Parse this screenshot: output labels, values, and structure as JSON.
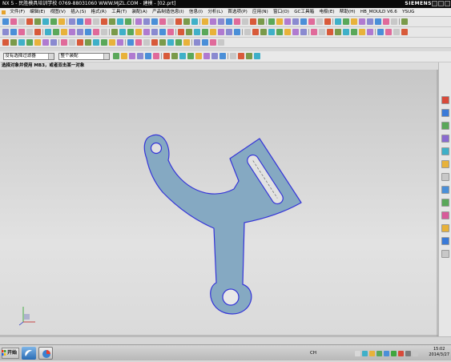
{
  "window": {
    "title": "NX 5 - 民胜模具培训学校 0769-88031060 WWW.MJZL.COM - 建模 - [02.prt]",
    "brand": "SIEMENS"
  },
  "menu": {
    "items": [
      "文件(F)",
      "编辑(E)",
      "视图(V)",
      "插入(S)",
      "格式(R)",
      "工具(T)",
      "装配(A)",
      "产品制造信息(I)",
      "信息(I)",
      "分析(L)",
      "首选项(P)",
      "应用(N)",
      "窗口(O)",
      "GC工具箱",
      "电极(E)",
      "帮助(H)",
      "HB_MOULD V6.6",
      "YSUG"
    ]
  },
  "selection": {
    "filter_value": "没有选择过滤器",
    "scope_value": "整个装配"
  },
  "cue": {
    "text": "选择对象并使用 MB3，或者双击某一对象"
  },
  "taskbar": {
    "start_label": "开始",
    "lang": "CH",
    "time": "15:02",
    "date": "2014/3/27"
  },
  "colors": {
    "part_fill": "#85a9c2",
    "part_edge": "#3535d8"
  }
}
